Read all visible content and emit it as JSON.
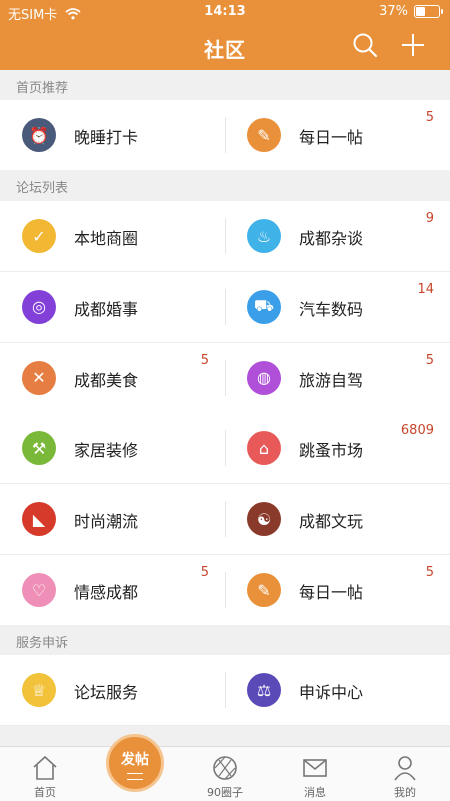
{
  "status": {
    "carrier": "无SIM卡",
    "time": "14:13",
    "battery": "37%",
    "battery_level": 0.37
  },
  "header": {
    "title": "社区"
  },
  "sections": {
    "recommend": "首页推荐",
    "forums": "论坛列表",
    "service": "服务申诉"
  },
  "recommend": [
    {
      "label": "晚睡打卡",
      "badge": "",
      "color": "#4a5a7a",
      "icon": "alarm-clock-icon"
    },
    {
      "label": "每日一帖",
      "badge": "5",
      "color": "#e8913a",
      "icon": "quill-icon"
    }
  ],
  "forums": [
    {
      "label": "本地商圈",
      "badge": "",
      "color": "#f2b733",
      "icon": "checkmark-icon"
    },
    {
      "label": "成都杂谈",
      "badge": "9",
      "color": "#3fb2e8",
      "icon": "tea-bowl-icon"
    },
    {
      "label": "成都婚事",
      "badge": "",
      "color": "#8240d8",
      "icon": "ring-icon"
    },
    {
      "label": "汽车数码",
      "badge": "14",
      "color": "#3a9ee8",
      "icon": "car-icon"
    },
    {
      "label": "成都美食",
      "badge": "5",
      "color": "#e67e43",
      "icon": "fork-knife-icon"
    },
    {
      "label": "旅游自驾",
      "badge": "5",
      "color": "#b050d8",
      "icon": "planet-icon"
    },
    {
      "label": "家居装修",
      "badge": "",
      "color": "#7ab83a",
      "icon": "hammer-icon"
    },
    {
      "label": "跳蚤市场",
      "badge": "6809",
      "color": "#e85a5a",
      "icon": "shop-icon"
    },
    {
      "label": "时尚潮流",
      "badge": "",
      "color": "#d63a2a",
      "icon": "high-heel-icon"
    },
    {
      "label": "成都文玩",
      "badge": "",
      "color": "#8a3a2a",
      "icon": "yin-yang-icon"
    },
    {
      "label": "情感成都",
      "badge": "5",
      "color": "#ef8fb8",
      "icon": "heart-icon"
    },
    {
      "label": "每日一帖",
      "badge": "5",
      "color": "#e8913a",
      "icon": "quill-icon"
    }
  ],
  "service": [
    {
      "label": "论坛服务",
      "badge": "",
      "color": "#f2c23a",
      "icon": "chef-hat-icon"
    },
    {
      "label": "申诉中心",
      "badge": "",
      "color": "#5a4ab8",
      "icon": "scale-icon"
    }
  ],
  "tabbar": {
    "home": "首页",
    "post": "发帖",
    "circle": "90圈子",
    "messages": "消息",
    "mine": "我的"
  }
}
